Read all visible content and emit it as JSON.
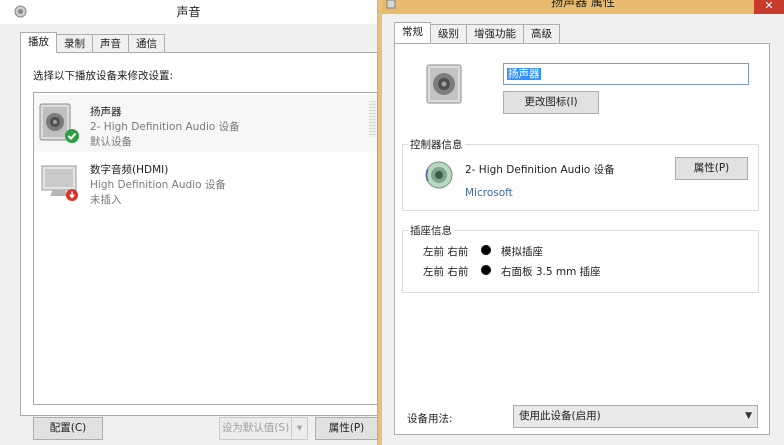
{
  "sound_window": {
    "title": "声音",
    "tabs": [
      {
        "label": "播放",
        "active": true
      },
      {
        "label": "录制",
        "active": false
      },
      {
        "label": "声音",
        "active": false
      },
      {
        "label": "通信",
        "active": false
      }
    ],
    "instruction": "选择以下播放设备来修改设置:",
    "devices": [
      {
        "name": "扬声器",
        "description": "2- High Definition Audio 设备",
        "status": "默认设备",
        "icon": "speaker-default-check-icon",
        "selected": true
      },
      {
        "name": "数字音频(HDMI)",
        "description": "High Definition Audio 设备",
        "status": "未插入",
        "icon": "monitor-unplugged-icon",
        "selected": false
      }
    ],
    "buttons": {
      "configure": "配置(C)",
      "set_default": "设为默认值(S)",
      "properties": "属性(P)"
    }
  },
  "props_window": {
    "title": "扬声器 属性",
    "close_label": "✕",
    "tabs": [
      {
        "label": "常规",
        "active": true
      },
      {
        "label": "级别",
        "active": false
      },
      {
        "label": "增强功能",
        "active": false
      },
      {
        "label": "高级",
        "active": false
      }
    ],
    "device_name_value": "扬声器",
    "change_icon_button": "更改图标(I)",
    "controller_group": {
      "title": "控制器信息",
      "name": "2- High Definition Audio 设备",
      "vendor": "Microsoft",
      "properties_button": "属性(P)"
    },
    "jack_group": {
      "title": "插座信息",
      "rows": [
        {
          "position": "左前 右前",
          "name": "模拟插座"
        },
        {
          "position": "左前 右前",
          "name": "右面板 3.5 mm 插座"
        }
      ]
    },
    "usage_label": "设备用法:",
    "usage_value": "使用此设备(启用)"
  },
  "colors": {
    "accent_selection": "#3390ff",
    "title_bar_active": "#e9bb6e",
    "close_button": "#c7392b",
    "vendor_link": "#3d6aa8",
    "status_ok_green": "#2ea043",
    "status_unplugged_red": "#d9342b"
  }
}
